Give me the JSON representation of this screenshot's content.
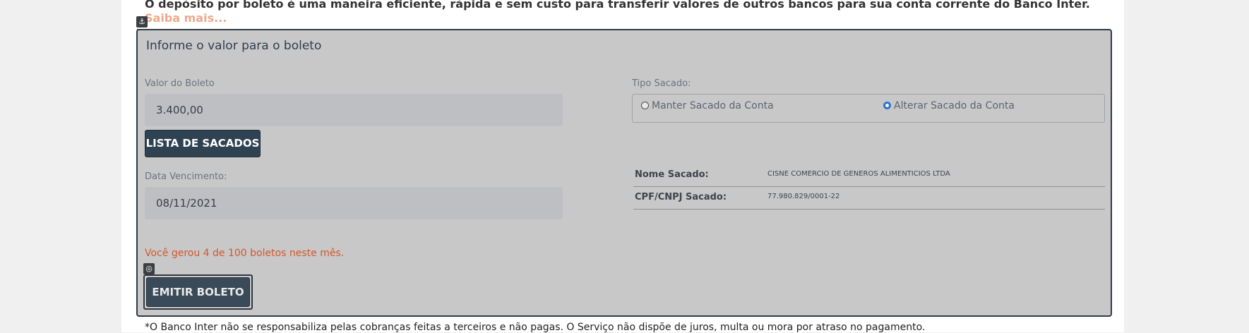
{
  "intro": {
    "text": "O depósito por boleto é uma maneira eficiente, rápida e sem custo para transferir valores de outros bancos para sua conta corrente do Banco Inter.",
    "link": "Saiba mais..."
  },
  "panel": {
    "title": "Informe o valor para o boleto"
  },
  "valor": {
    "label": "Valor do Boleto",
    "value": "3.400,00"
  },
  "lista_button": "LISTA DE SACADOS",
  "vencimento": {
    "label": "Data Vencimento:",
    "value": "08/11/2021"
  },
  "tipo_sacado": {
    "label": "Tipo Sacado:",
    "options": [
      {
        "label": "Manter Sacado da Conta",
        "checked": false
      },
      {
        "label": "Alterar Sacado da Conta",
        "checked": true
      }
    ]
  },
  "sacado_info": [
    {
      "key": "Nome Sacado:",
      "value": "CISNE COMERCIO DE GENEROS ALIMENTICIOS LTDA"
    },
    {
      "key": "CPF/CNPJ Sacado:",
      "value": "77.980.829/0001-22"
    }
  ],
  "notice": "Você gerou 4 de 100 boletos neste mês.",
  "emitir_button": "EMITIR BOLETO",
  "footer_note": "*O Banco Inter não se responsabiliza pelas cobranças feitas a terceiros e não pagas. O Serviço não dispõe de juros, multa ou mora por atraso no pagamento.",
  "colors": {
    "panel_bg": "#c8c8c9",
    "button_bg": "#2f4252",
    "notice": "#d2582a",
    "radio_checked": "#2a74d6"
  },
  "icons": {
    "anchor": "anchor-icon",
    "target": "target-icon"
  }
}
